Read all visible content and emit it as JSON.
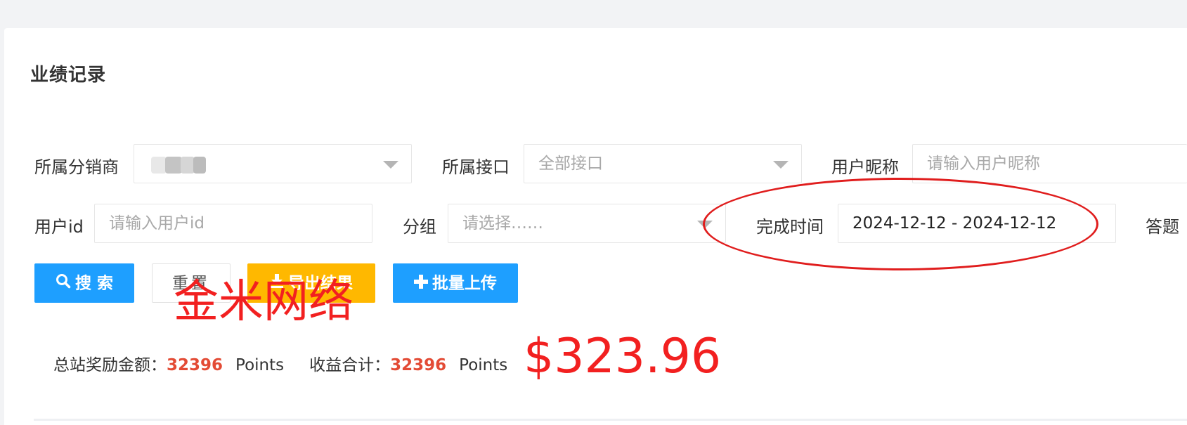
{
  "page": {
    "title": "业绩记录"
  },
  "filters": {
    "distributor_label": "所属分销商",
    "interface_label": "所属接口",
    "interface_value": "全部接口",
    "nickname_label": "用户昵称",
    "nickname_placeholder": "请输入用户昵称",
    "userid_label": "用户id",
    "userid_placeholder": "请输入用户id",
    "group_label": "分组",
    "group_placeholder": "请选择……",
    "time_label": "完成时间",
    "time_value": "2024-12-12 - 2024-12-12",
    "answer_label": "答题"
  },
  "buttons": {
    "search": "搜 索",
    "reset": "重置",
    "export": "导出结果",
    "upload": "批量上传"
  },
  "stats": {
    "reward_label": "总站奖励金额：",
    "reward_value": "32396",
    "reward_unit": "Points",
    "income_label": "收益合计：",
    "income_value": "32396",
    "income_unit": "Points"
  },
  "annotations": {
    "watermark": "金米网络",
    "amount": "$323.96"
  },
  "colors": {
    "primary": "#1e9fff",
    "warning": "#ffb800",
    "highlight_number": "#e34b35",
    "annotation_red": "#f22020"
  }
}
